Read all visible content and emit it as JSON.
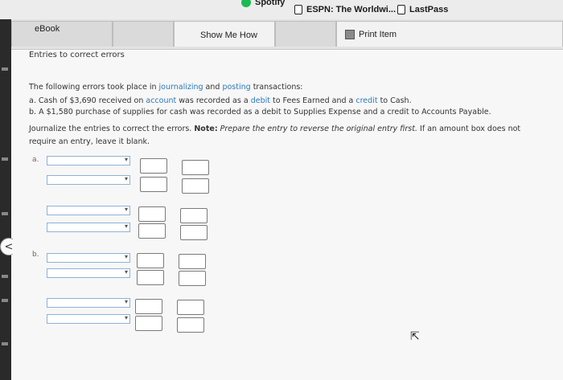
{
  "browser": {
    "bookmarks": [
      {
        "label": "Spotify",
        "icon": "spotify-icon"
      },
      {
        "label": "ESPN: The Worldwi...",
        "icon": "page-icon"
      },
      {
        "label": "LastPass",
        "icon": "page-icon"
      }
    ]
  },
  "tabs": {
    "ebook": "eBook",
    "show_me_how": "Show Me How",
    "print_item": "Print Item"
  },
  "content": {
    "title": "Entries to correct errors",
    "intro_pre": "The following errors took place in ",
    "intro_link1": "journalizing",
    "intro_mid": " and ",
    "intro_link2": "posting",
    "intro_post": " transactions:",
    "error_a": {
      "pre": "a. Cash of $3,690 received on ",
      "link1": "account",
      "mid1": " was recorded as a ",
      "link2": "debit",
      "mid2": " to Fees Earned and a ",
      "link3": "credit",
      "post": " to Cash."
    },
    "error_b": "b. A $1,580 purchase of supplies for cash was recorded as a debit to Supplies Expense and a credit to Accounts Payable.",
    "instr_pre": "Journalize the entries to correct the errors. ",
    "instr_note": "Note:",
    "instr_italic": " Prepare the entry to reverse the original entry first.",
    "instr_post": " If an amount box does not",
    "instr_line2": "require an entry, leave it blank."
  },
  "journal": {
    "label_a": "a.",
    "label_b": "b."
  },
  "colors": {
    "link": "#2a7ab8",
    "dropdown_border": "#8fb1d6",
    "spotify_green": "#1db954"
  }
}
